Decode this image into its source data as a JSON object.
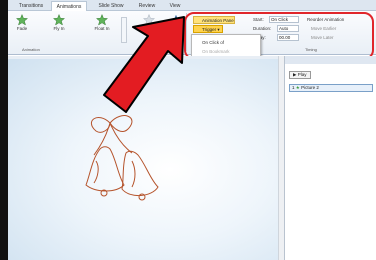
{
  "tabs": [
    "Transitions",
    "Animations",
    "Slide Show",
    "Review",
    "View"
  ],
  "ribbon": {
    "buttons": [
      "Fade",
      "Fly In",
      "Float In",
      "Effect"
    ],
    "group_label": "Animation"
  },
  "advanced": {
    "animation_pane": "Animation Pane",
    "trigger": "Trigger",
    "start_label": "Start:",
    "start_value": "On Click",
    "duration_label": "Duration:",
    "duration_value": "Auto",
    "delay_label": "Delay:",
    "delay_value": "00.00",
    "reorder_title": "Reorder Animation",
    "move_earlier": "Move Earlier",
    "move_later": "Move Later",
    "timing_label": "Timing"
  },
  "trigger_menu": {
    "on_click_of": "On Click of",
    "on_bookmark": "On Bookmark"
  },
  "anim_pane": {
    "play_label": "Play",
    "item_number": "1",
    "item_name": "Picture 2"
  },
  "colors": {
    "highlight": "#e0262b",
    "pane_button": "#ffe27a",
    "bells": "#b5532b"
  }
}
